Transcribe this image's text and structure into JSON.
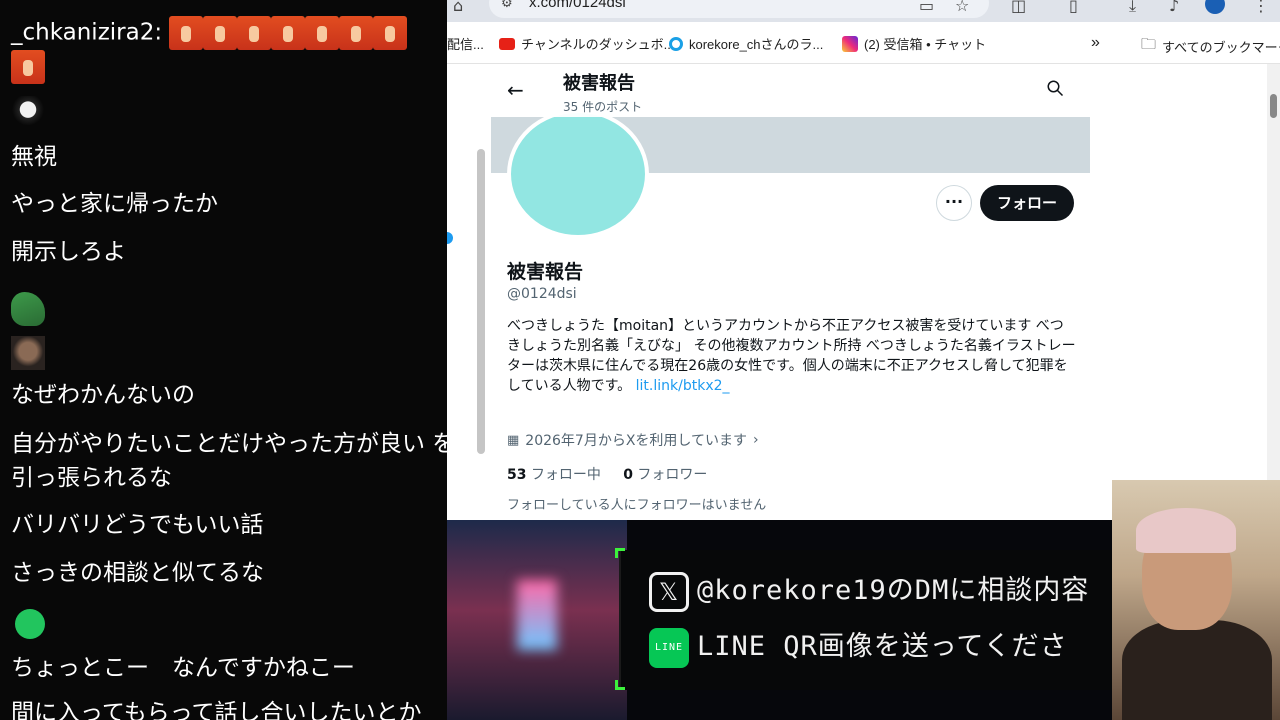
{
  "chat": {
    "messages": [
      {
        "user": "_chkanizira2:",
        "text": ""
      },
      {
        "text": "無視"
      },
      {
        "text": "やっと家に帰ったか"
      },
      {
        "text": "開示しろよ"
      },
      {
        "text": "なぜわかんないの"
      },
      {
        "text": "自分がやりたいことだけやった方が良い を引っ張られるな"
      },
      {
        "text": "バリバリどうでもいい話"
      },
      {
        "text": "さっきの相談と似てるな"
      },
      {
        "text": "ちょっとこー　なんですかねこー"
      },
      {
        "text": "間に入ってもらって話し合いしたいとか"
      }
    ]
  },
  "browser": {
    "url": "x.com/0124dsi",
    "bookmarks": [
      {
        "label": "配信..."
      },
      {
        "label": "チャンネルのダッシュボ..."
      },
      {
        "label": "korekore_chさんのラ..."
      },
      {
        "label": "(2) 受信箱 • チャット"
      },
      {
        "label": "すべてのブックマーク"
      }
    ],
    "overflow": "»"
  },
  "profile": {
    "header_name": "被害報告",
    "header_posts": "35 件のポスト",
    "more_label": "···",
    "follow_label": "フォロー",
    "name": "被害報告",
    "handle": "@0124dsi",
    "bio": "べつきしょうた【moitan】というアカウントから不正アクセス被害を受けています べつきしょうた別名義「えびな」 その他複数アカウント所持 べつきしょうた名義イラストレーターは茨木県に住んでる現在26歳の女性です。個人の端末に不正アクセスし脅して犯罪をしている人物です。",
    "bio_link": "lit.link/btkx2_",
    "joined": "2026年7月からXを利用しています",
    "following_count": "53",
    "following_label": "フォロー中",
    "followers_count": "0",
    "followers_label": "フォロワー",
    "no_followers": "フォローしている人にフォロワーはいません"
  },
  "promo": {
    "line1": "@korekore19のDMに相談内容",
    "line2": "LINE QR画像を送ってくださ"
  },
  "colors": {
    "follow": "#0f1419",
    "link": "#1d9bf0",
    "avatar": "#92e6e2",
    "banner": "#cfd9de"
  }
}
